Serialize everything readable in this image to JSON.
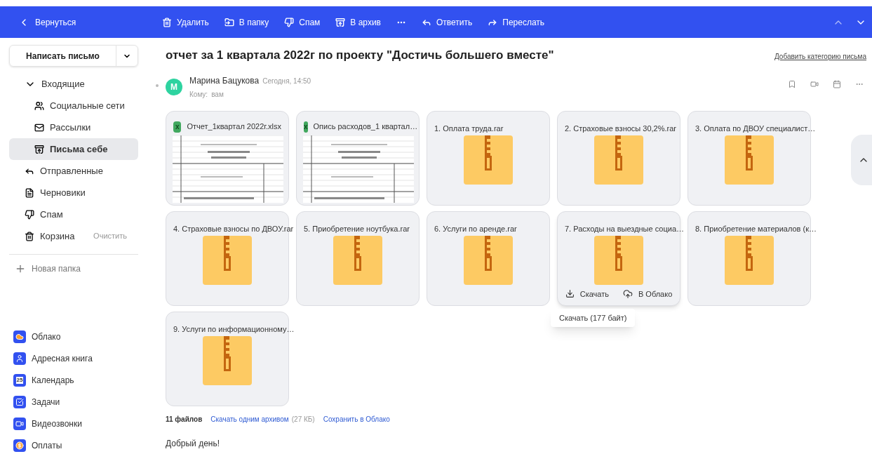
{
  "toolbar": {
    "back": "Вернуться",
    "actions": [
      {
        "kind": "delete",
        "label": "Удалить"
      },
      {
        "kind": "folder",
        "label": "В папку"
      },
      {
        "kind": "spam",
        "label": "Спам"
      },
      {
        "kind": "archive",
        "label": "В архив"
      },
      {
        "kind": "more"
      },
      {
        "kind": "reply",
        "label": "Ответить"
      },
      {
        "kind": "forward",
        "label": "Переслать"
      }
    ]
  },
  "sidebar": {
    "compose": "Написать письмо",
    "folders": [
      {
        "kind": "inbox",
        "label": "Входящие",
        "selected": false,
        "expanded": true,
        "children": [
          {
            "kind": "social",
            "label": "Социальные сети",
            "selected": false
          },
          {
            "kind": "newsletters",
            "label": "Рассылки",
            "selected": false
          },
          {
            "kind": "self",
            "label": "Письма себе",
            "selected": true
          }
        ]
      },
      {
        "kind": "sent",
        "label": "Отправленные",
        "selected": false
      },
      {
        "kind": "drafts",
        "label": "Черновики",
        "selected": false
      },
      {
        "kind": "spam",
        "label": "Спам",
        "selected": false
      },
      {
        "kind": "trash",
        "label": "Корзина",
        "selected": false,
        "action": "Очистить"
      }
    ],
    "new_folder": "Новая папка",
    "apps": [
      {
        "kind": "cloud",
        "label": "Облако"
      },
      {
        "kind": "contacts",
        "label": "Адресная книга"
      },
      {
        "kind": "calendar",
        "label": "Календарь",
        "icon_text": "25"
      },
      {
        "kind": "tasks",
        "label": "Задачи"
      },
      {
        "kind": "video",
        "label": "Видеозвонки"
      },
      {
        "kind": "payments",
        "label": "Оплаты"
      }
    ]
  },
  "message": {
    "subject": "отчет за 1 квартала 2022г по проекту \"Достичь большего вместе\"",
    "add_category": "Добавить категорию письма",
    "sender": {
      "avatar": "М",
      "name": "Марина Бацукова",
      "time": "Сегодня, 14:50",
      "to_label": "Кому:",
      "to": "вам"
    },
    "attachments": [
      {
        "kind": "spreadsheet",
        "icon_text": "x",
        "name": "Отчет_1квартал 2022г.xlsx",
        "hovered": false
      },
      {
        "kind": "spreadsheet",
        "icon_text": "x",
        "name": "Опись расходов_1 квартал…",
        "hovered": false
      },
      {
        "kind": "archive",
        "name": "1. Оплата труда.rar",
        "hovered": false
      },
      {
        "kind": "archive",
        "name": "2. Страховые взносы 30,2%.rar",
        "hovered": false
      },
      {
        "kind": "archive",
        "name": "3. Оплата по ДВОУ специалист…",
        "hovered": false
      },
      {
        "kind": "archive",
        "name": "4. Страховые взносы по ДВОУ.rar",
        "hovered": false
      },
      {
        "kind": "archive",
        "name": "5. Приобретение ноутбука.rar",
        "hovered": false
      },
      {
        "kind": "archive",
        "name": "6. Услуги по аренде.rar",
        "hovered": false
      },
      {
        "kind": "archive",
        "name": "7. Расходы на выездные социа…",
        "hovered": true,
        "download": "Скачать",
        "to_cloud": "В Облако",
        "tooltip": "Скачать (177 байт)"
      },
      {
        "kind": "archive",
        "name": "8. Приобретение материалов (к…",
        "hovered": false
      },
      {
        "kind": "archive",
        "name": "9. Услуги по информационному…",
        "hovered": false
      }
    ],
    "summary": {
      "count": "11 файлов",
      "download_all": "Скачать одним архивом",
      "size": "(27 КБ)",
      "save_cloud": "Сохранить в Облако"
    },
    "body": "Добрый день!"
  }
}
